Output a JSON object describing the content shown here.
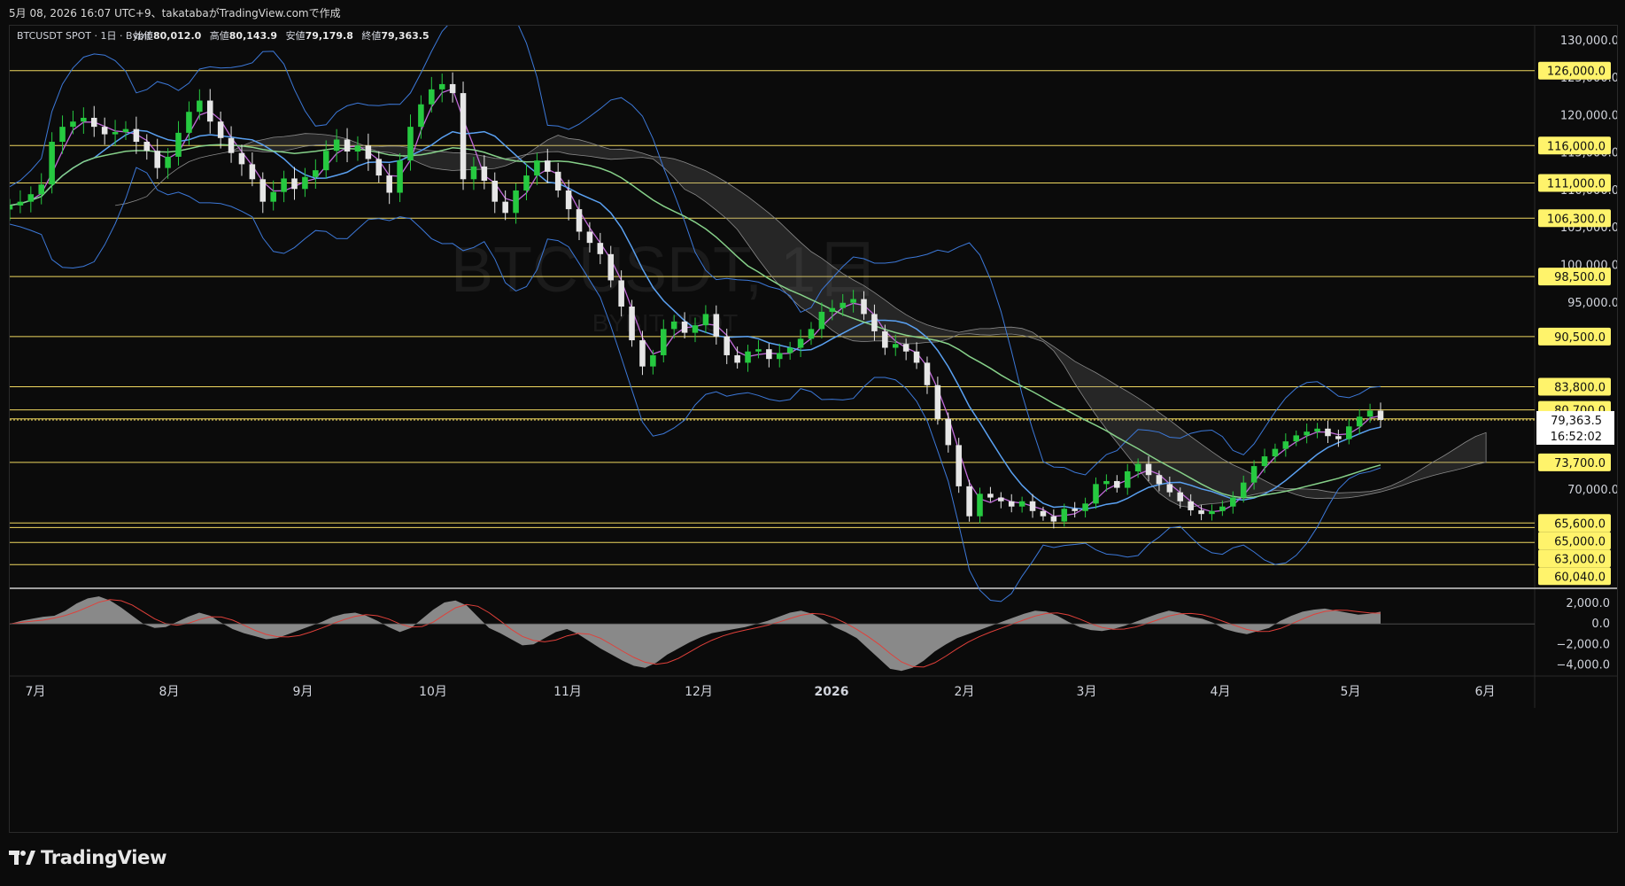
{
  "header": {
    "snapshot_line": "5月 08, 2026 16:07 UTC+9、takatabaがTradingView.comで作成"
  },
  "legend": {
    "symbol": "BTCUSDT SPOT · 1日 · Bybit",
    "open_label": "始値",
    "open_value": "80,012.0",
    "high_label": "高値",
    "high_value": "80,143.9",
    "low_label": "安値",
    "low_value": "79,179.8",
    "close_label": "終値",
    "close_value": "79,363.5"
  },
  "watermark": {
    "line1": "BTCUSDT, 1日",
    "line2": "BYBIT SPOT"
  },
  "footer": {
    "brand": "TradingView"
  },
  "colors": {
    "background": "#0b0b0b",
    "grid": "#1c1c1c",
    "up_candle": "#26c940",
    "down_candle": "#e6e6e6",
    "level_line": "#f0d860",
    "level_label_bg": "#fff36b",
    "bollinger": "#3c78d8",
    "ma_short": "#c06ad8",
    "ma_mid": "#5aa0f0",
    "ma_long": "#86d089",
    "cloud": "#6e6e6e",
    "macd_hist": "#a0a0a0",
    "macd_signal": "#e0403a",
    "current_price_bg": "#ffffff"
  },
  "chart_data": [
    {
      "type": "candlestick",
      "title": "BTCUSDT SPOT · 1日 · Bybit",
      "price_axis_ticks": [
        "130,000.0",
        "125,000.0",
        "120,000.0",
        "115,000.0",
        "110,000.0",
        "105,000.0",
        "100,000.0",
        "95,000.0",
        "70,000.0"
      ],
      "ylim": [
        57000,
        132000
      ],
      "time_axis_labels": [
        "7月",
        "8月",
        "9月",
        "10月",
        "11月",
        "12月",
        "2026",
        "2月",
        "3月",
        "4月",
        "5月",
        "6月"
      ],
      "horizontal_levels": [
        "126,000.0",
        "116,000.0",
        "111,000.0",
        "106,300.0",
        "98,500.0",
        "90,500.0",
        "83,800.0",
        "80,700.0",
        "79,500.0",
        "73,700.0",
        "65,600.0",
        "65,000.0",
        "63,000.0",
        "60,040.0"
      ],
      "current_price": "79,363.5",
      "countdown": "16:52:02",
      "close_series": [
        108000,
        108500,
        109500,
        110800,
        116500,
        118500,
        119200,
        119700,
        118500,
        117500,
        117800,
        118200,
        116500,
        115300,
        113000,
        114500,
        117700,
        120500,
        122000,
        119200,
        117000,
        115000,
        113500,
        111500,
        108500,
        109800,
        111600,
        110200,
        111800,
        112700,
        115300,
        116800,
        115200,
        116000,
        114200,
        112000,
        109700,
        114000,
        118500,
        121500,
        123500,
        124200,
        123000,
        111500,
        113200,
        111300,
        108500,
        107000,
        110000,
        112000,
        114000,
        112500,
        110000,
        107500,
        104500,
        103000,
        101500,
        98000,
        94500,
        90000,
        86500,
        88000,
        91500,
        92500,
        91000,
        92000,
        93500,
        90500,
        88000,
        87000,
        88500,
        88800,
        87500,
        88300,
        89000,
        90200,
        91500,
        93800,
        94300,
        95000,
        95500,
        93500,
        91200,
        89000,
        89500,
        88500,
        87000,
        84000,
        79500,
        76000,
        70500,
        66500,
        69500,
        69000,
        68500,
        67800,
        68500,
        67200,
        66500,
        65800,
        67500,
        67200,
        68200,
        70800,
        71200,
        70300,
        72500,
        73500,
        72000,
        70800,
        69700,
        68500,
        67300,
        66800,
        67200,
        67800,
        69000,
        71000,
        73200,
        74500,
        75500,
        76500,
        77300,
        77800,
        78200,
        77200,
        76800,
        78500,
        79800,
        80600,
        79363.5
      ]
    },
    {
      "type": "histogram",
      "title": "MACD",
      "y_axis_ticks": [
        "2,000.0",
        "0.0",
        "−2,000.0",
        "−4,000.0"
      ],
      "ylim": [
        -5100,
        3400
      ],
      "hist_series": [
        0,
        300,
        500,
        700,
        800,
        1300,
        2000,
        2500,
        2700,
        2300,
        1600,
        800,
        0,
        -400,
        -300,
        200,
        700,
        1100,
        800,
        100,
        -500,
        -900,
        -1200,
        -1500,
        -1400,
        -1000,
        -600,
        -200,
        200,
        700,
        1000,
        1100,
        800,
        300,
        -300,
        -800,
        -400,
        500,
        1400,
        2100,
        2300,
        1800,
        700,
        -400,
        -900,
        -1500,
        -2100,
        -2000,
        -1400,
        -800,
        -500,
        -1000,
        -1700,
        -2400,
        -3000,
        -3600,
        -4100,
        -4300,
        -3800,
        -3000,
        -2400,
        -1800,
        -1300,
        -900,
        -700,
        -500,
        -300,
        0,
        300,
        700,
        1100,
        1300,
        1000,
        400,
        -300,
        -800,
        -1400,
        -2400,
        -3400,
        -4400,
        -4600,
        -4300,
        -3600,
        -2700,
        -2000,
        -1400,
        -1000,
        -600,
        -200,
        200,
        600,
        1000,
        1300,
        1200,
        800,
        200,
        -300,
        -600,
        -700,
        -500,
        -200,
        200,
        600,
        1000,
        1300,
        1100,
        700,
        500,
        100,
        -500,
        -800,
        -1000,
        -700,
        -400,
        300,
        800,
        1200,
        1400,
        1500,
        1300,
        1100,
        900,
        1000,
        1200
      ]
    }
  ]
}
